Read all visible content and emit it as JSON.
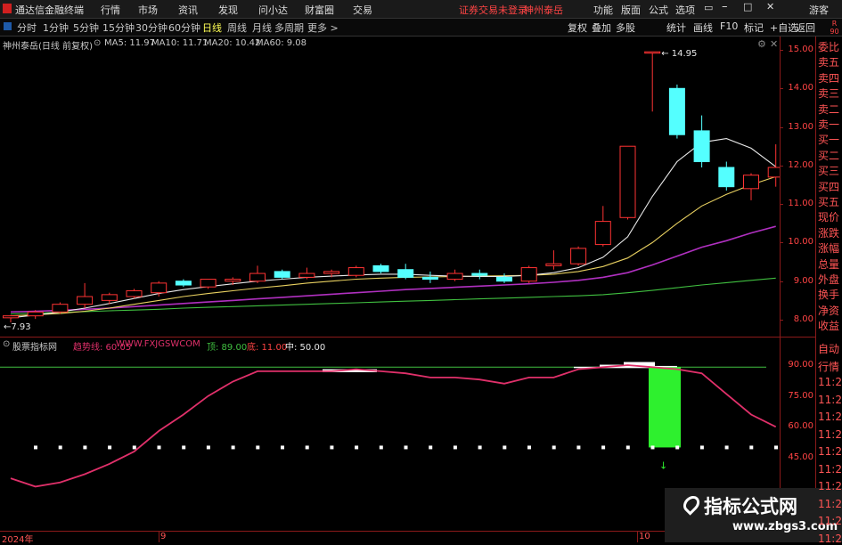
{
  "titlebar": {
    "app_name": "通达信金融终端",
    "menus": [
      "行情",
      "市场",
      "资讯",
      "发现",
      "问小达",
      "财富圈",
      "交易"
    ],
    "broker_status": "证券交易未登录",
    "stock_name": "神州泰岳",
    "right_menus": [
      "功能",
      "版面",
      "公式",
      "选项"
    ],
    "guest": "游客"
  },
  "periodbar": {
    "periods": [
      "分时",
      "1分钟",
      "5分钟",
      "15分钟",
      "30分钟",
      "60分钟",
      "日线",
      "周线",
      "月线",
      "多周期",
      "更多 >"
    ],
    "active": "日线",
    "right_buttons": [
      "复权",
      "叠加",
      "多股",
      "统计",
      "画线",
      "F10",
      "标记",
      "+自选",
      "返回"
    ]
  },
  "main_chart": {
    "title": "神州泰岳(日线 前复权)",
    "ma": [
      {
        "label": "MA5: 11.97",
        "color": "#e8e8e8"
      },
      {
        "label": "MA10: 11.71",
        "color": "#e8d060"
      },
      {
        "label": "MA20: 10.42",
        "color": "#d040d0"
      },
      {
        "label": "MA60: 9.08",
        "color": "#40c040"
      }
    ],
    "y_ticks": [
      "15.00",
      "14.00",
      "13.00",
      "12.00",
      "11.00",
      "10.00",
      "9.00",
      "8.00"
    ],
    "high_label": "14.95",
    "low_label": "7.93",
    "candles": [
      [
        8.05,
        8.12,
        7.93,
        8.1
      ],
      [
        8.1,
        8.25,
        8.02,
        8.2
      ],
      [
        8.2,
        8.45,
        8.15,
        8.4
      ],
      [
        8.4,
        8.95,
        8.3,
        8.6
      ],
      [
        8.5,
        8.7,
        8.4,
        8.65
      ],
      [
        8.6,
        8.8,
        8.55,
        8.75
      ],
      [
        8.7,
        9.0,
        8.6,
        8.95
      ],
      [
        9.0,
        9.05,
        8.85,
        8.9
      ],
      [
        8.85,
        9.05,
        8.8,
        9.05
      ],
      [
        9.0,
        9.1,
        8.9,
        9.05
      ],
      [
        9.0,
        9.4,
        8.95,
        9.2
      ],
      [
        9.25,
        9.3,
        9.05,
        9.1
      ],
      [
        9.1,
        9.35,
        9.05,
        9.2
      ],
      [
        9.2,
        9.3,
        9.1,
        9.25
      ],
      [
        9.15,
        9.4,
        9.1,
        9.35
      ],
      [
        9.4,
        9.45,
        9.2,
        9.25
      ],
      [
        9.3,
        9.45,
        9.05,
        9.1
      ],
      [
        9.1,
        9.25,
        8.95,
        9.05
      ],
      [
        9.05,
        9.3,
        9.0,
        9.2
      ],
      [
        9.2,
        9.3,
        9.05,
        9.15
      ],
      [
        9.1,
        9.2,
        8.95,
        9.0
      ],
      [
        9.0,
        9.4,
        8.95,
        9.35
      ],
      [
        9.4,
        9.8,
        9.3,
        9.45
      ],
      [
        9.45,
        9.9,
        9.4,
        9.85
      ],
      [
        9.95,
        10.95,
        9.9,
        10.55
      ],
      [
        10.65,
        12.5,
        10.6,
        12.5
      ],
      [
        14.95,
        14.95,
        13.4,
        14.95
      ],
      [
        14.0,
        14.1,
        12.7,
        12.8
      ],
      [
        12.9,
        13.3,
        11.95,
        12.1
      ],
      [
        11.95,
        12.1,
        11.35,
        11.45
      ],
      [
        11.4,
        11.8,
        11.1,
        11.75
      ],
      [
        11.7,
        12.55,
        11.45,
        11.95
      ]
    ],
    "ma_values": {
      "ma5": [
        8.05,
        8.12,
        8.2,
        8.3,
        8.42,
        8.55,
        8.68,
        8.78,
        8.86,
        8.93,
        9.0,
        9.05,
        9.1,
        9.13,
        9.16,
        9.18,
        9.18,
        9.15,
        9.13,
        9.12,
        9.12,
        9.15,
        9.22,
        9.35,
        9.62,
        10.15,
        11.2,
        12.1,
        12.6,
        12.7,
        12.45,
        11.97
      ],
      "ma10": [
        8.1,
        8.13,
        8.16,
        8.22,
        8.3,
        8.4,
        8.5,
        8.6,
        8.68,
        8.75,
        8.82,
        8.88,
        8.95,
        9.0,
        9.05,
        9.08,
        9.1,
        9.11,
        9.12,
        9.13,
        9.14,
        9.15,
        9.18,
        9.25,
        9.38,
        9.6,
        10.0,
        10.5,
        10.95,
        11.25,
        11.5,
        11.71
      ],
      "ma20": [
        8.2,
        8.22,
        8.24,
        8.27,
        8.3,
        8.34,
        8.38,
        8.42,
        8.46,
        8.5,
        8.54,
        8.58,
        8.62,
        8.66,
        8.7,
        8.74,
        8.78,
        8.81,
        8.84,
        8.87,
        8.9,
        8.93,
        8.97,
        9.02,
        9.1,
        9.22,
        9.42,
        9.65,
        9.88,
        10.05,
        10.25,
        10.42
      ],
      "ma60": [
        8.15,
        8.17,
        8.19,
        8.21,
        8.23,
        8.25,
        8.27,
        8.3,
        8.32,
        8.34,
        8.36,
        8.38,
        8.4,
        8.42,
        8.44,
        8.46,
        8.48,
        8.5,
        8.52,
        8.54,
        8.56,
        8.58,
        8.6,
        8.62,
        8.65,
        8.7,
        8.76,
        8.83,
        8.9,
        8.96,
        9.02,
        9.08
      ]
    }
  },
  "indicator": {
    "title": "股票指标网",
    "legend": [
      {
        "label": "趋势线: 60.05",
        "color": "#e0306a"
      },
      {
        "label": "WWW.FXJGSWCOM",
        "color": "#e0306a"
      },
      {
        "label": "·",
        "color": "#e0306a"
      },
      {
        "label": "顶: 89.00",
        "color": "#40c040"
      },
      {
        "label": "底: 11.00",
        "color": "#ff4444"
      },
      {
        "label": "中: 50.00",
        "color": "#e8e8e8"
      }
    ],
    "y_ticks": [
      "90.00",
      "75.00",
      "60.00",
      "45.00"
    ],
    "trend": [
      35,
      31,
      33,
      37,
      42,
      48,
      58,
      66,
      75,
      82,
      87,
      87,
      87,
      87,
      88,
      87,
      86,
      84,
      84,
      83,
      81,
      84,
      84,
      88,
      89,
      90,
      89,
      88,
      86,
      76,
      66,
      60
    ],
    "top_line": 89,
    "mid_line": 50,
    "dots_count": 31
  },
  "right_panel": {
    "top": [
      "委比",
      "卖五",
      "卖四",
      "卖三",
      "卖二",
      "卖一",
      "买一",
      "买二",
      "买三",
      "买四",
      "买五",
      "现价",
      "涨跌",
      "涨幅",
      "总量",
      "外盘",
      "换手",
      "净资",
      "收益"
    ],
    "bottom": [
      "自动",
      "行情",
      "11:2",
      "11:2",
      "11:2",
      "11:2",
      "11:2",
      "11:2",
      "11:2",
      "11:2",
      "11:2",
      "11:2"
    ]
  },
  "timeline": {
    "labels": [
      "2024年",
      "9",
      "10"
    ]
  },
  "watermark": {
    "title": "指标公式网",
    "url": "www.zbgs3.com"
  }
}
